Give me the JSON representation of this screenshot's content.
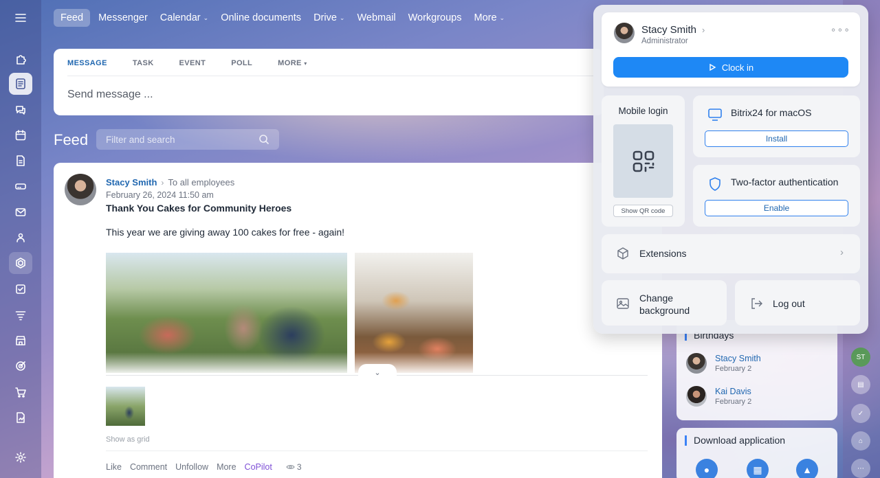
{
  "topnav": {
    "items": [
      {
        "label": "Feed",
        "active": true,
        "dropdown": false
      },
      {
        "label": "Messenger",
        "active": false,
        "dropdown": false
      },
      {
        "label": "Calendar",
        "active": false,
        "dropdown": true
      },
      {
        "label": "Online documents",
        "active": false,
        "dropdown": false
      },
      {
        "label": "Drive",
        "active": false,
        "dropdown": true
      },
      {
        "label": "Webmail",
        "active": false,
        "dropdown": false
      },
      {
        "label": "Workgroups",
        "active": false,
        "dropdown": false
      },
      {
        "label": "More",
        "active": false,
        "dropdown": true
      }
    ]
  },
  "composer": {
    "tabs": [
      "MESSAGE",
      "TASK",
      "EVENT",
      "POLL",
      "MORE"
    ],
    "placeholder": "Send message ..."
  },
  "feed": {
    "title": "Feed",
    "filter_placeholder": "Filter and search"
  },
  "post": {
    "author": "Stacy Smith",
    "audience": "To all employees",
    "date": "February 26, 2024 11:50 am",
    "title": "Thank You Cakes for Community Heroes",
    "text": "This year we are giving away 100 cakes for free - again!",
    "show_grid": "Show as grid",
    "actions": {
      "like": "Like",
      "comment": "Comment",
      "unfollow": "Unfollow",
      "more": "More",
      "copilot": "CoPilot",
      "views": "3"
    }
  },
  "birthdays": {
    "title": "Birthdays",
    "people": [
      {
        "name": "Stacy Smith",
        "date": "February 2"
      },
      {
        "name": "Kai Davis",
        "date": "February 2"
      }
    ]
  },
  "download": {
    "title": "Download application"
  },
  "right_rail": {
    "initials": "ST"
  },
  "profile": {
    "name": "Stacy Smith",
    "role": "Administrator",
    "clock_in": "Clock in",
    "mobile_login": "Mobile login",
    "show_qr": "Show QR code",
    "mac_title": "Bitrix24 for macOS",
    "mac_button": "Install",
    "tfa_title": "Two-factor authentication",
    "tfa_button": "Enable",
    "extensions": "Extensions",
    "change_background": "Change background",
    "logout": "Log out"
  },
  "colors": {
    "accent": "#1e88f5",
    "link": "#2067b0",
    "copilot": "#7e4fd6"
  }
}
